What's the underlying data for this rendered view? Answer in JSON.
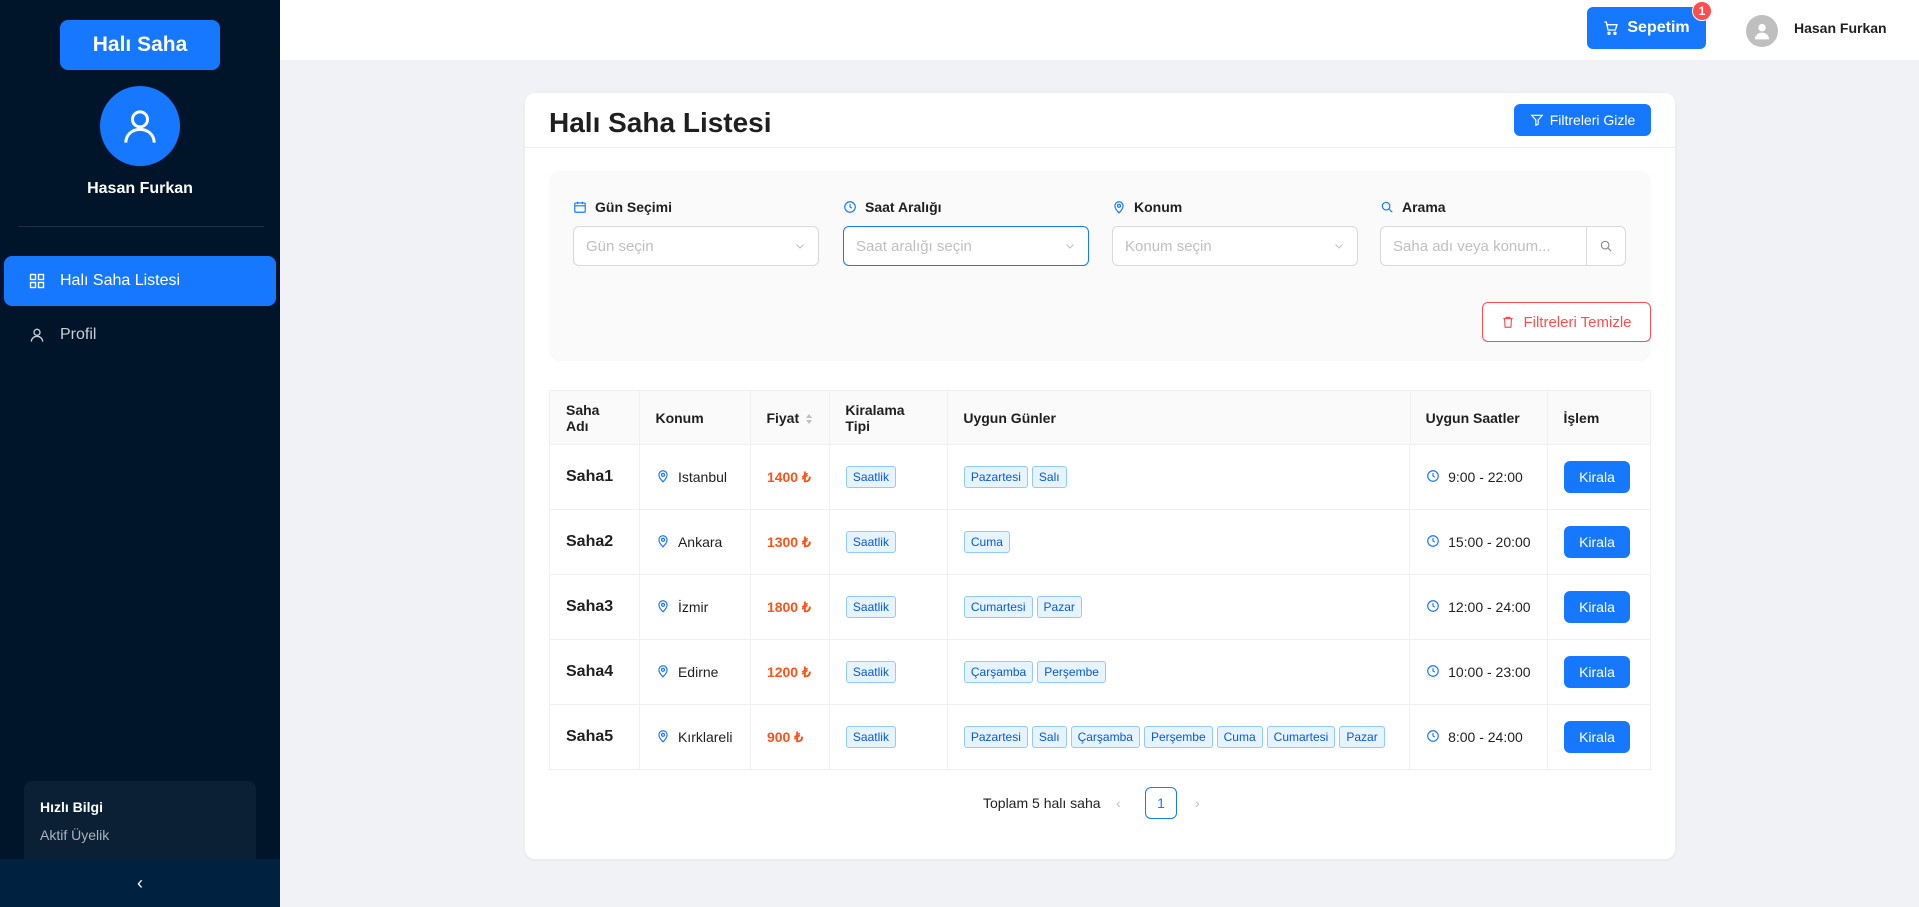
{
  "sidebar": {
    "brand": "Halı Saha",
    "user_name": "Hasan Furkan",
    "menu": [
      {
        "label": "Halı Saha Listesi",
        "icon": "grid-icon",
        "active": true
      },
      {
        "label": "Profil",
        "icon": "user-icon",
        "active": false
      }
    ],
    "quick_info": {
      "title": "Hızlı Bilgi",
      "subtitle": "Aktif Üyelik"
    },
    "collapse_glyph": "‹"
  },
  "header": {
    "cart_label": "Sepetim",
    "cart_count": "1",
    "user_name": "Hasan Furkan"
  },
  "page": {
    "title": "Halı Saha Listesi",
    "hide_filters_label": "Filtreleri Gizle"
  },
  "filters": {
    "day": {
      "label": "Gün Seçimi",
      "placeholder": "Gün seçin"
    },
    "time": {
      "label": "Saat Aralığı",
      "placeholder": "Saat aralığı seçin"
    },
    "location": {
      "label": "Konum",
      "placeholder": "Konum seçin"
    },
    "search": {
      "label": "Arama",
      "placeholder": "Saha adı veya konum..."
    },
    "clear_label": "Filtreleri Temizle"
  },
  "table": {
    "columns": [
      "Saha Adı",
      "Konum",
      "Fiyat",
      "Kiralama Tipi",
      "Uygun Günler",
      "Uygun Saatler",
      "İşlem"
    ],
    "rows": [
      {
        "name": "Saha1",
        "location": "Istanbul",
        "price": "1400 ₺",
        "type": "Saatlik",
        "days": [
          "Pazartesi",
          "Salı"
        ],
        "hours": "9:00 - 22:00",
        "action": "Kirala"
      },
      {
        "name": "Saha2",
        "location": "Ankara",
        "price": "1300 ₺",
        "type": "Saatlik",
        "days": [
          "Cuma"
        ],
        "hours": "15:00 - 20:00",
        "action": "Kirala"
      },
      {
        "name": "Saha3",
        "location": "İzmir",
        "price": "1800 ₺",
        "type": "Saatlik",
        "days": [
          "Cumartesi",
          "Pazar"
        ],
        "hours": "12:00 - 24:00",
        "action": "Kirala"
      },
      {
        "name": "Saha4",
        "location": "Edirne",
        "price": "1200 ₺",
        "type": "Saatlik",
        "days": [
          "Çarşamba",
          "Perşembe"
        ],
        "hours": "10:00 - 23:00",
        "action": "Kirala"
      },
      {
        "name": "Saha5",
        "location": "Kırklareli",
        "price": "900 ₺",
        "type": "Saatlik",
        "days": [
          "Pazartesi",
          "Salı",
          "Çarşamba",
          "Perşembe",
          "Cuma",
          "Cumartesi",
          "Pazar"
        ],
        "hours": "8:00 - 24:00",
        "action": "Kirala"
      }
    ]
  },
  "pagination": {
    "total_text": "Toplam 5 halı saha",
    "current_page": "1",
    "prev": "‹",
    "next": "›"
  },
  "colors": {
    "primary": "#1677ff",
    "sidebar": "#001529",
    "danger": "#ff4d4f",
    "price": "#fa541c"
  }
}
